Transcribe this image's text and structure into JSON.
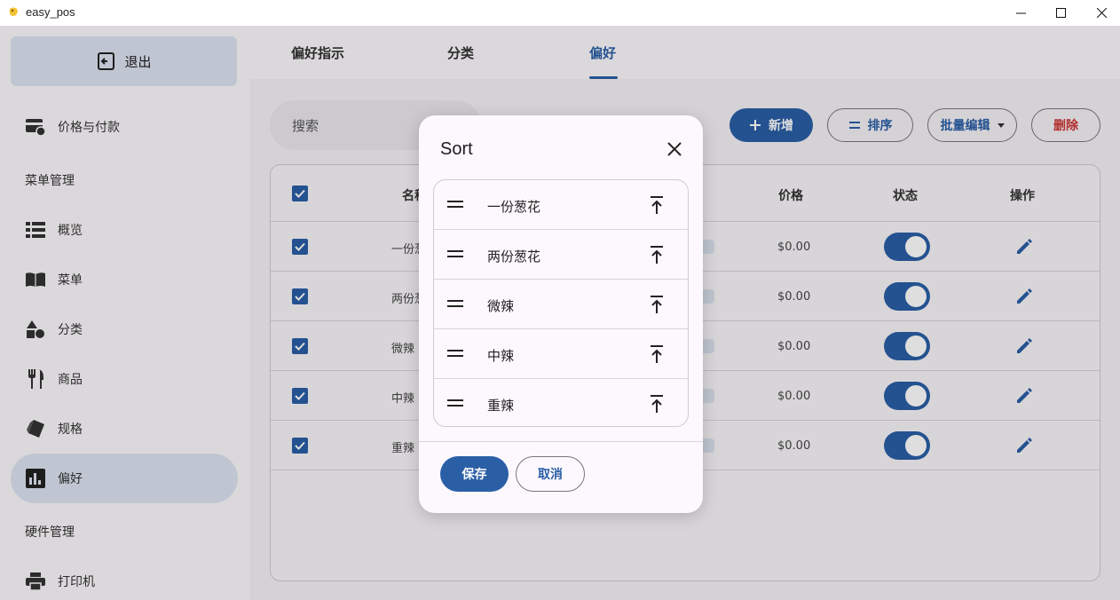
{
  "window": {
    "title": "easy_pos",
    "minimize_icon": "minimize-icon",
    "maximize_icon": "maximize-icon",
    "close_icon": "close-icon"
  },
  "sidebar": {
    "logout_label": "退出",
    "sections": [
      "菜单管理",
      "硬件管理"
    ],
    "items": [
      {
        "label": "价格与付款",
        "icon": "price-payment-icon"
      },
      {
        "label": "概览",
        "icon": "list-icon"
      },
      {
        "label": "菜单",
        "icon": "book-icon"
      },
      {
        "label": "分类",
        "icon": "shapes-icon"
      },
      {
        "label": "商品",
        "icon": "utensils-icon"
      },
      {
        "label": "规格",
        "icon": "tag-icon"
      },
      {
        "label": "偏好",
        "icon": "chart-icon",
        "active": true
      },
      {
        "label": "打印机",
        "icon": "printer-icon"
      }
    ]
  },
  "tabs": [
    {
      "label": "偏好指示"
    },
    {
      "label": "分类"
    },
    {
      "label": "偏好",
      "active": true
    }
  ],
  "toolbar": {
    "search_placeholder": "搜索",
    "new_label": "新增",
    "sort_label": "排序",
    "bulk_edit_label": "批量编辑",
    "delete_label": "删除"
  },
  "table": {
    "headers": {
      "name": "名称",
      "price": "价格",
      "status": "状态",
      "actions": "操作"
    },
    "rows": [
      {
        "name": "一份葱花",
        "price": "$0.00",
        "enabled": true,
        "selected": true
      },
      {
        "name": "两份葱花",
        "price": "$0.00",
        "enabled": true,
        "selected": true
      },
      {
        "name": "微辣",
        "price": "$0.00",
        "enabled": true,
        "selected": true
      },
      {
        "name": "中辣",
        "price": "$0.00",
        "enabled": true,
        "selected": true
      },
      {
        "name": "重辣",
        "price": "$0.00",
        "enabled": true,
        "selected": true
      }
    ]
  },
  "dialog": {
    "title": "Sort",
    "items": [
      "一份葱花",
      "两份葱花",
      "微辣",
      "中辣",
      "重辣"
    ],
    "save_label": "保存",
    "cancel_label": "取消"
  },
  "colors": {
    "primary": "#2a5fa6",
    "danger": "#cc3333",
    "surface": "#fdf8fd"
  }
}
